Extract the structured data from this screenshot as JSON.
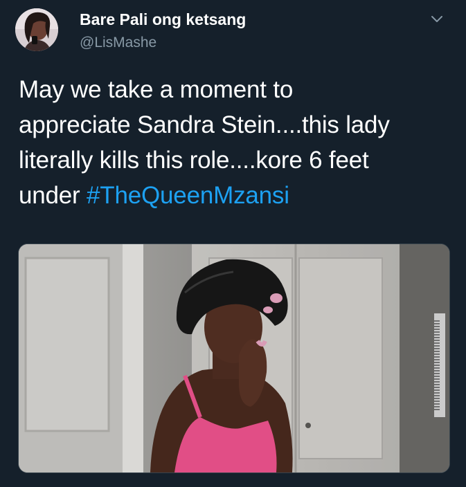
{
  "tweet": {
    "author": {
      "display_name": "Bare Pali ong ketsang",
      "handle": "@LisMashe",
      "avatar_icon": "profile-photo"
    },
    "menu_icon": "chevron-down-icon",
    "text_lines": [
      "May we take a moment to",
      "appreciate Sandra Stein....this lady",
      "literally kills this role....kore 6 feet",
      "under "
    ],
    "hashtag": "#TheQueenMzansi",
    "media": {
      "kind": "image",
      "description_icon": "photo"
    }
  },
  "colors": {
    "background": "#15202b",
    "primary_text": "#ffffff",
    "secondary_text": "#8899a6",
    "link": "#1da1f2",
    "border": "#38444d"
  }
}
